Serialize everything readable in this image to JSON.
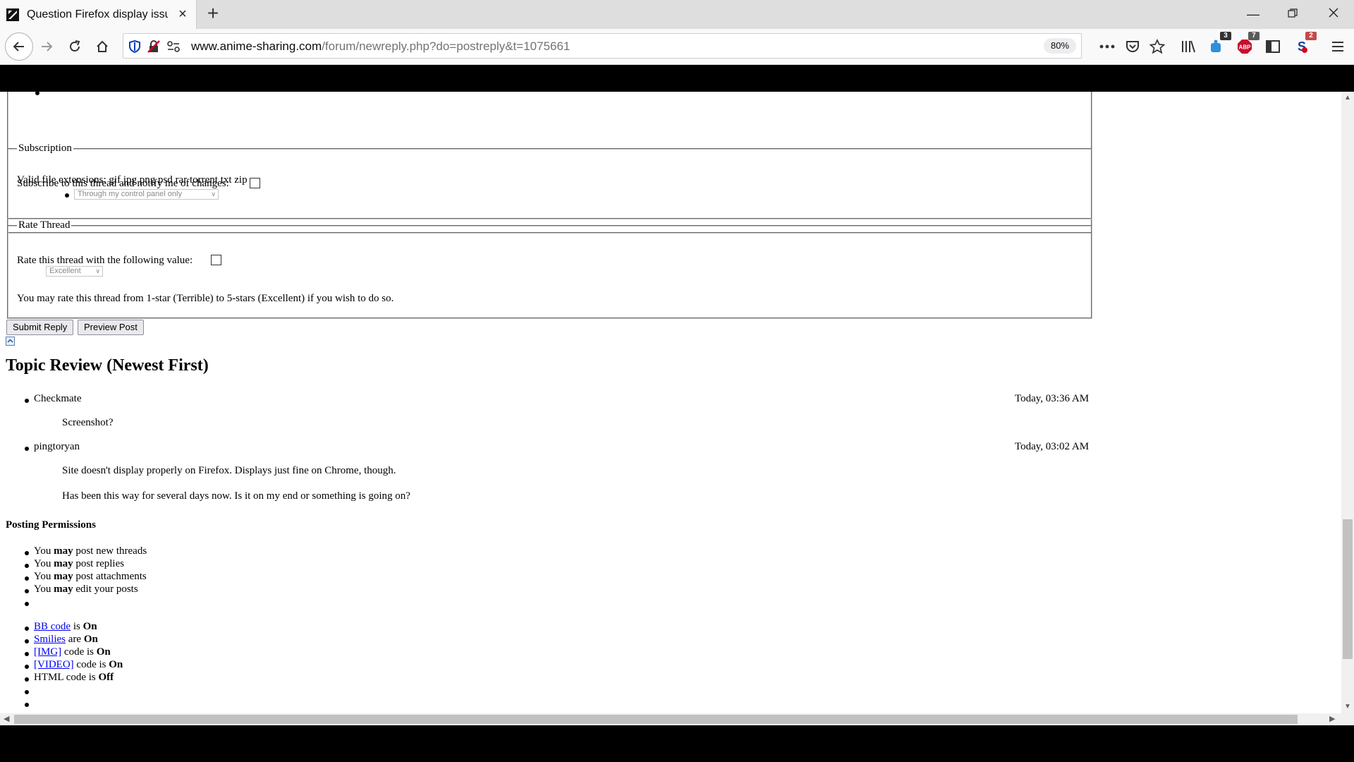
{
  "browser": {
    "tab_title": "Question Firefox display issue",
    "url_host": "www.anime-sharing.com",
    "url_path": "/forum/newreply.php?do=postreply&t=1075661",
    "zoom": "80%",
    "badges": {
      "ext_blue": "3",
      "adblock": "7",
      "ext_s": "2"
    }
  },
  "attachments": {
    "valid_ext": "Valid file extensions: gif jpg png psd rar torrent txt zip"
  },
  "subscription": {
    "legend": "Subscription",
    "label": "Subscribe to this thread and notify me of changes:",
    "select_value": "Through my control panel only"
  },
  "rate": {
    "legend": "Rate Thread",
    "label": "Rate this thread with the following value:",
    "select_value": "Excellent",
    "note": "You may rate this thread from 1-star (Terrible) to 5-stars (Excellent) if you wish to do so."
  },
  "buttons": {
    "submit": "Submit Reply",
    "preview": "Preview Post"
  },
  "review": {
    "heading": "Topic Review (Newest First)",
    "posts": [
      {
        "user": "Checkmate",
        "time": "Today, 03:36 AM",
        "lines": [
          "Screenshot?"
        ]
      },
      {
        "user": "pingtoryan",
        "time": "Today, 03:02 AM",
        "lines": [
          "Site doesn't display properly on Firefox. Displays just fine on Chrome, though.",
          "Has been this way for several days now. Is it on my end or something is going on?"
        ]
      }
    ]
  },
  "permissions": {
    "heading": "Posting Permissions",
    "you": "You",
    "may": "may",
    "items": [
      "post new threads",
      "post replies",
      "post attachments",
      "edit your posts"
    ],
    "codes": [
      {
        "link": "BB code",
        "mid": "is",
        "val": "On"
      },
      {
        "link": "Smilies",
        "mid": "are",
        "val": "On"
      },
      {
        "link": "[IMG]",
        "mid": "code is",
        "val": "On"
      },
      {
        "link": "[VIDEO]",
        "mid": "code is",
        "val": "On"
      }
    ],
    "html": {
      "label": "HTML code is",
      "val": "Off"
    }
  }
}
